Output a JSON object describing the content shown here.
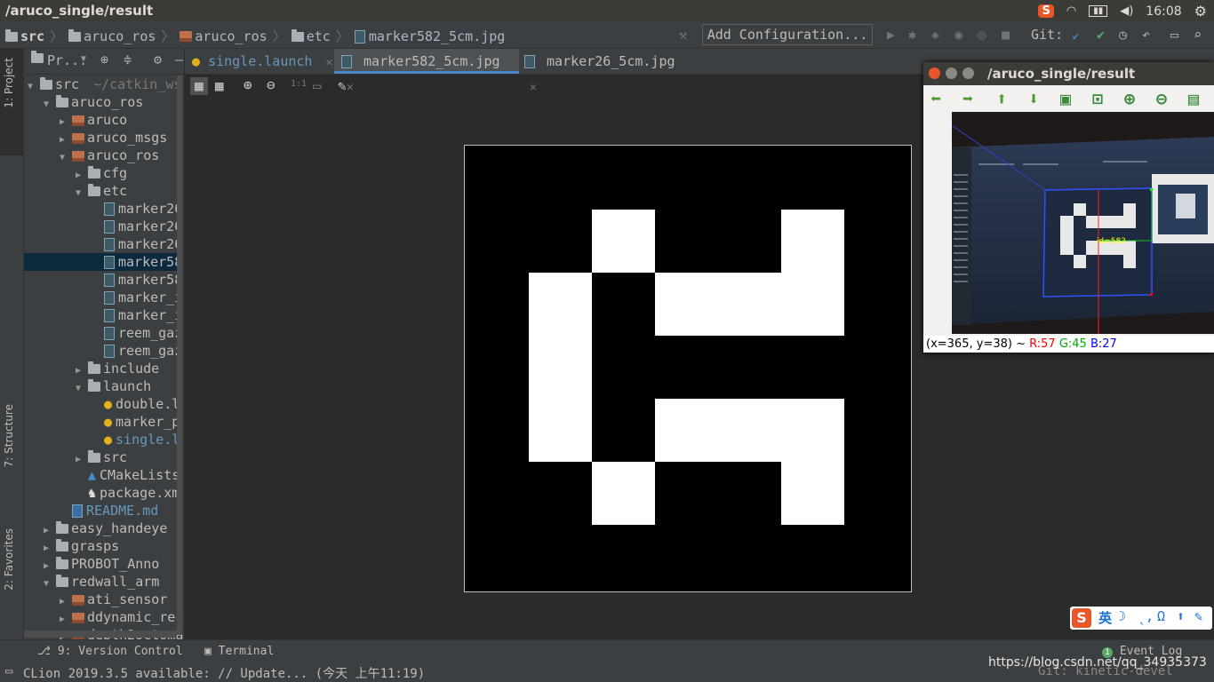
{
  "topbar": {
    "title": "/aruco_single/result",
    "time": "16:08",
    "ime_icon": "sogou-icon"
  },
  "navbar": {
    "crumbs": [
      "src",
      "aruco_ros",
      "aruco_ros",
      "etc",
      "marker582_5cm.jpg"
    ],
    "add_config": "Add Configuration...",
    "git_label": "Git:"
  },
  "leftstrip": {
    "project_tab": "1: Project",
    "structure_tab": "7: Structure",
    "favorites_tab": "2: Favorites"
  },
  "project": {
    "header": "Pr...",
    "tree": [
      {
        "label": "src",
        "extra": "~/catkin_ws",
        "kind": "folder",
        "expanded": true
      },
      {
        "label": "aruco_ros",
        "kind": "folder",
        "expanded": true
      },
      {
        "label": "aruco",
        "kind": "module",
        "expanded": false
      },
      {
        "label": "aruco_msgs",
        "kind": "module",
        "expanded": false
      },
      {
        "label": "aruco_ros",
        "kind": "module",
        "expanded": true
      },
      {
        "label": "cfg",
        "kind": "folder",
        "expanded": false
      },
      {
        "label": "etc",
        "kind": "folder",
        "expanded": true
      },
      {
        "label": "marker26",
        "kind": "file"
      },
      {
        "label": "marker26",
        "kind": "file"
      },
      {
        "label": "marker26",
        "kind": "file"
      },
      {
        "label": "marker58",
        "kind": "file",
        "selected": true
      },
      {
        "label": "marker58",
        "kind": "file"
      },
      {
        "label": "marker_i",
        "kind": "file"
      },
      {
        "label": "marker_i",
        "kind": "file"
      },
      {
        "label": "reem_gaz",
        "kind": "file"
      },
      {
        "label": "reem_gaz",
        "kind": "file"
      },
      {
        "label": "include",
        "kind": "folder",
        "expanded": false
      },
      {
        "label": "launch",
        "kind": "folder",
        "expanded": true
      },
      {
        "label": "double.l",
        "kind": "launch"
      },
      {
        "label": "marker_p",
        "kind": "launch"
      },
      {
        "label": "single.l",
        "kind": "launch",
        "highlight": true
      },
      {
        "label": "src",
        "kind": "folder",
        "expanded": false
      },
      {
        "label": "CMakeLists",
        "kind": "cmake"
      },
      {
        "label": "package.xm",
        "kind": "xml"
      },
      {
        "label": "README.md",
        "kind": "md",
        "highlight": true
      },
      {
        "label": "easy_handeye",
        "kind": "folder",
        "expanded": false
      },
      {
        "label": "grasps",
        "kind": "folder",
        "expanded": false
      },
      {
        "label": "PROBOT_Anno",
        "kind": "folder",
        "expanded": false
      },
      {
        "label": "redwall_arm",
        "kind": "folder",
        "expanded": true
      },
      {
        "label": "ati_sensor",
        "kind": "module",
        "expanded": false
      },
      {
        "label": "ddynamic_rec",
        "kind": "module",
        "expanded": false
      },
      {
        "label": "depth2octoma",
        "kind": "module",
        "expanded": false
      }
    ]
  },
  "editor": {
    "tabs": [
      {
        "label": "single.launch",
        "active": false,
        "highlight": true
      },
      {
        "label": "marker582_5cm.jpg",
        "active": true
      },
      {
        "label": "marker26_5cm.jpg",
        "active": false
      }
    ],
    "zoom_label": "1:1"
  },
  "result_window": {
    "title": "/aruco_single/result",
    "status_prefix": "(x=365, y=38) ~",
    "r": "R:57",
    "g": "G:45",
    "b": "B:27",
    "marker_id_label": "id=582",
    "colors": {
      "r": "#ff0000",
      "g": "#00aa00",
      "b": "#0000ff"
    }
  },
  "bottom": {
    "version_control": "9: Version Control",
    "terminal": "Terminal",
    "event_log": "Event Log",
    "event_count": "1"
  },
  "statusbar": {
    "message": "CLion 2019.3.5 available: // Update... (今天 上午11:19)",
    "git": "Git: kinetic-devel",
    "watermark": "https://blog.csdn.net/qq_34935373"
  },
  "ime": {
    "label": "英"
  }
}
